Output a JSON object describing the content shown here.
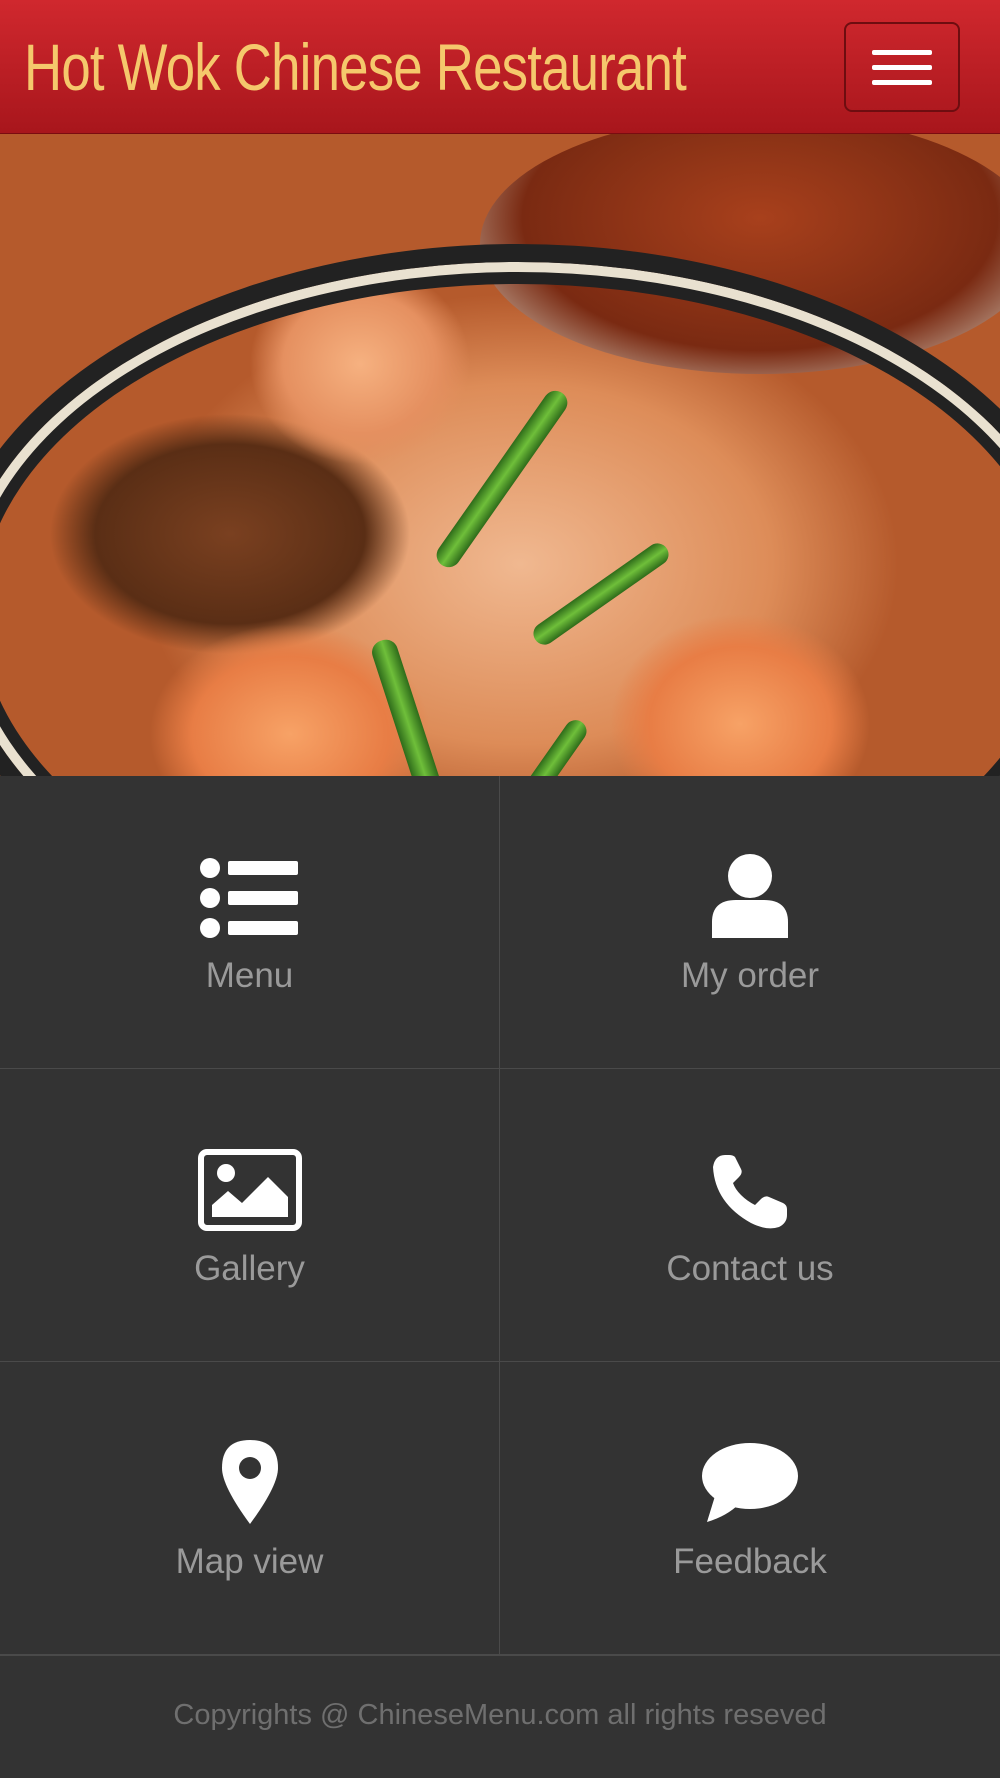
{
  "header": {
    "title": "Hot Wok Chinese Restaurant",
    "menu_icon": "hamburger-icon"
  },
  "hero": {
    "image": "food-photo-noodles-shrimp"
  },
  "tiles": [
    {
      "label": "Menu",
      "icon": "list-icon"
    },
    {
      "label": "My order",
      "icon": "user-icon"
    },
    {
      "label": "Gallery",
      "icon": "image-icon"
    },
    {
      "label": "Contact us",
      "icon": "phone-icon"
    },
    {
      "label": "Map view",
      "icon": "map-marker-icon"
    },
    {
      "label": "Feedback",
      "icon": "comment-icon"
    }
  ],
  "footer": {
    "copyright": "Copyrights @ ChineseMenu.com all rights reseved"
  },
  "colors": {
    "header_red": "#c0222a",
    "title_gold": "#f5c86c",
    "tile_bg": "#333333",
    "label_gray": "#9a9a9a"
  }
}
